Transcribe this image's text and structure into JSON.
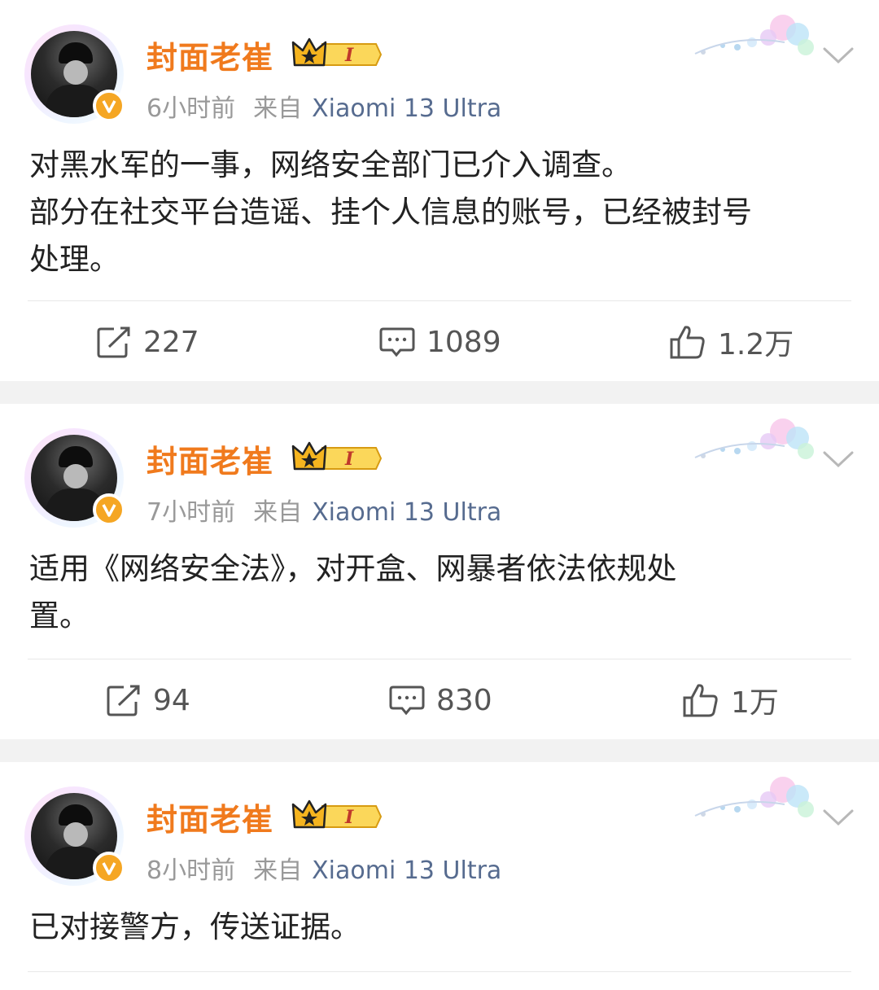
{
  "posts": [
    {
      "username": "封面老崔",
      "member_level": "I",
      "time": "6小时前",
      "source_prefix": "来自",
      "device": "Xiaomi 13 Ultra",
      "text_lines": [
        "对黑水军的一事，网络安全部门已介入调查。",
        "部分在社交平台造谣、挂个人信息的账号，已经被封号",
        "处理。"
      ],
      "repost_count": "227",
      "comment_count": "1089",
      "like_count": "1.2万"
    },
    {
      "username": "封面老崔",
      "member_level": "I",
      "time": "7小时前",
      "source_prefix": "来自",
      "device": "Xiaomi 13 Ultra",
      "text_lines": [
        "适用《网络安全法》，对开盒、网暴者依法依规处",
        "置。"
      ],
      "repost_count": "94",
      "comment_count": "830",
      "like_count": "1万"
    },
    {
      "username": "封面老崔",
      "member_level": "I",
      "time": "8小时前",
      "source_prefix": "来自",
      "device": "Xiaomi 13 Ultra",
      "text_lines": [
        "已对接警方，传送证据。"
      ]
    }
  ],
  "colors": {
    "username": "#f07a1d",
    "device": "#566b8f",
    "meta": "#999999",
    "text": "#222222",
    "verified_badge": "#f5a623"
  },
  "icons": {
    "repost": "repost-icon",
    "comment": "comment-icon",
    "like": "thumbs-up-icon",
    "verified": "verified-v-icon",
    "member": "crown-member-icon",
    "menu": "chevron-down-icon"
  }
}
